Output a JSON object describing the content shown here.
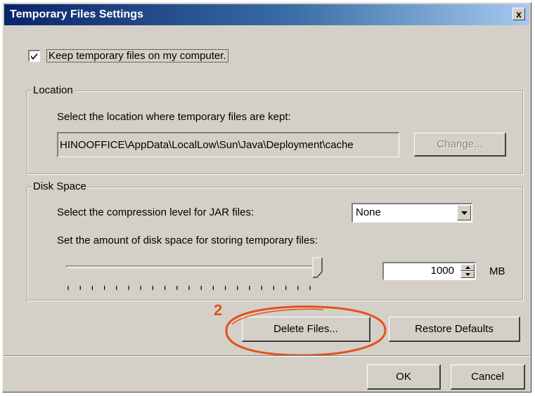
{
  "dialog": {
    "title": "Temporary Files Settings",
    "close_label": "x"
  },
  "keep_files": {
    "label": "Keep temporary files on my computer.",
    "checked": true
  },
  "location": {
    "legend": "Location",
    "description": "Select the location where temporary files are kept:",
    "path": "HINOOFFICE\\AppData\\LocalLow\\Sun\\Java\\Deployment\\cache",
    "change_label": "Change...",
    "change_enabled": false
  },
  "disk_space": {
    "legend": "Disk Space",
    "compression_label": "Select the compression level for JAR files:",
    "compression_value": "None",
    "amount_label": "Set the amount of disk space for storing temporary files:",
    "slider_level": 1.0,
    "amount_value": "1000",
    "unit": "MB"
  },
  "actions": {
    "delete_label": "Delete Files...",
    "restore_label": "Restore Defaults"
  },
  "footer": {
    "ok_label": "OK",
    "cancel_label": "Cancel"
  },
  "annotation": {
    "step_number": "2",
    "color": "#e3521f"
  },
  "colors": {
    "dialog_face": "#d4d0c8",
    "title_start": "#0a246a",
    "title_end": "#a6caf0"
  }
}
